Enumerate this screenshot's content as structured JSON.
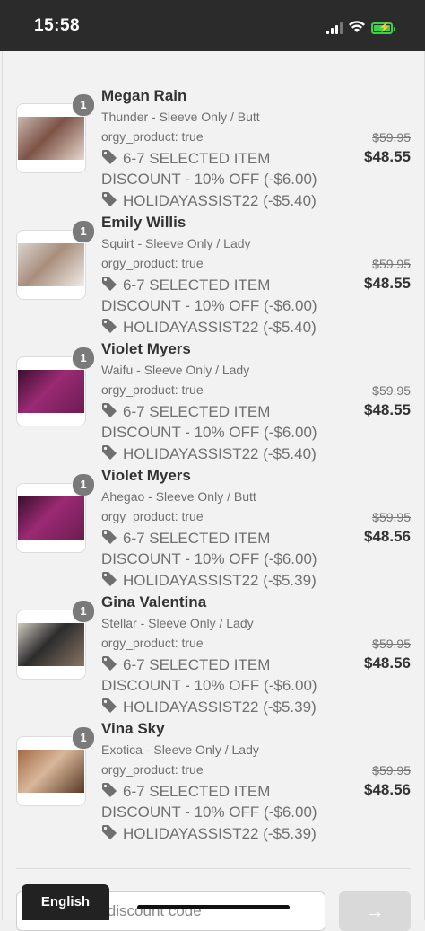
{
  "status_bar": {
    "time": "15:58"
  },
  "items": [
    {
      "quantity": "1",
      "title": "Megan Rain",
      "variant": "Thunder - Sleeve Only / Butt",
      "property": "orgy_product: true",
      "discount_line": "6-7 SELECTED ITEM DISCOUNT - 10% OFF (-$6.00)",
      "code_line": "HOLIDAYASSIST22 (-$5.40)",
      "original_price": "$59.95",
      "price": "$48.55",
      "thumb_colors": [
        "#c9b8ae",
        "#7d5347",
        "#e7d7cd"
      ]
    },
    {
      "quantity": "1",
      "title": "Emily Willis",
      "variant": "Squirt - Sleeve Only / Lady",
      "property": "orgy_product: true",
      "discount_line": "6-7 SELECTED ITEM DISCOUNT - 10% OFF (-$6.00)",
      "code_line": "HOLIDAYASSIST22 (-$5.40)",
      "original_price": "$59.95",
      "price": "$48.55",
      "thumb_colors": [
        "#d9d4cf",
        "#a88e7c",
        "#f0ece8"
      ]
    },
    {
      "quantity": "1",
      "title": "Violet Myers",
      "variant": "Waifu - Sleeve Only / Lady",
      "property": "orgy_product: true",
      "discount_line": "6-7 SELECTED ITEM DISCOUNT - 10% OFF (-$6.00)",
      "code_line": "HOLIDAYASSIST22 (-$5.40)",
      "original_price": "$59.95",
      "price": "$48.55",
      "thumb_colors": [
        "#3a0f2e",
        "#9b2a73",
        "#6c1d52"
      ]
    },
    {
      "quantity": "1",
      "title": "Violet Myers",
      "variant": "Ahegao - Sleeve Only / Butt",
      "property": "orgy_product: true",
      "discount_line": "6-7 SELECTED ITEM DISCOUNT - 10% OFF (-$6.00)",
      "code_line": "HOLIDAYASSIST22 (-$5.39)",
      "original_price": "$59.95",
      "price": "$48.56",
      "thumb_colors": [
        "#3a0f2e",
        "#9b2a73",
        "#6c1d52"
      ]
    },
    {
      "quantity": "1",
      "title": "Gina Valentina",
      "variant": "Stellar - Sleeve Only / Lady",
      "property": "orgy_product: true",
      "discount_line": "6-7 SELECTED ITEM DISCOUNT - 10% OFF (-$6.00)",
      "code_line": "HOLIDAYASSIST22 (-$5.39)",
      "original_price": "$59.95",
      "price": "$48.56",
      "thumb_colors": [
        "#cfc9c0",
        "#2c2c2c",
        "#8a7464"
      ]
    },
    {
      "quantity": "1",
      "title": "Vina Sky",
      "variant": "Exotica - Sleeve Only / Lady",
      "property": "orgy_product: true",
      "discount_line": "6-7 SELECTED ITEM DISCOUNT - 10% OFF (-$6.00)",
      "code_line": "HOLIDAYASSIST22 (-$5.39)",
      "original_price": "$59.95",
      "price": "$48.56",
      "thumb_colors": [
        "#a26a45",
        "#d8b79a",
        "#5a3a26"
      ]
    }
  ],
  "discount": {
    "placeholder": "Gift card or discount code",
    "button_icon": "arrow-right-icon"
  },
  "language": {
    "label": "English"
  },
  "icons": {
    "tag": "price-tag-icon"
  }
}
